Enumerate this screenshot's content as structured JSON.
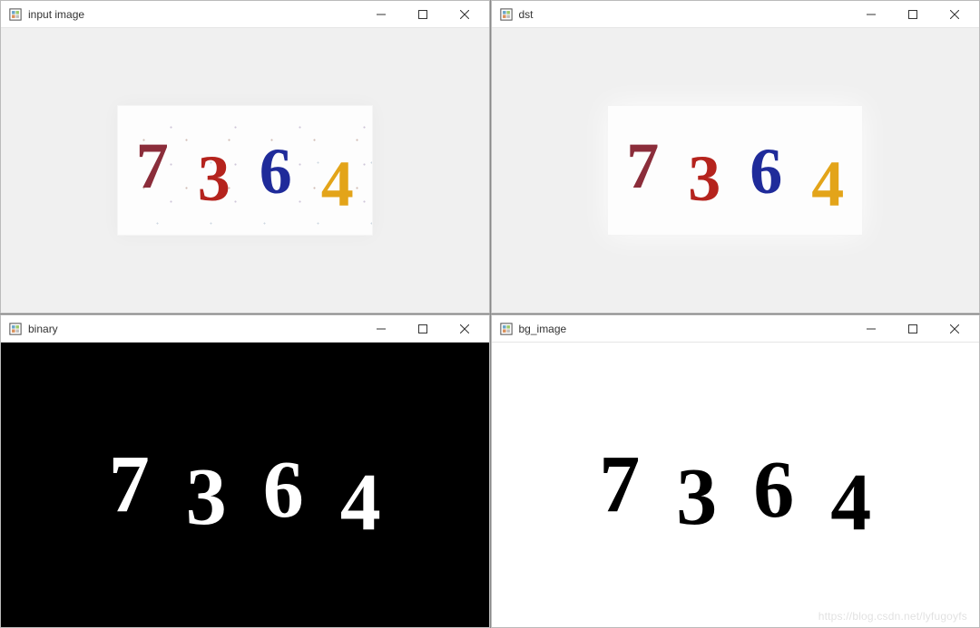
{
  "windows": [
    {
      "title": "input image"
    },
    {
      "title": "dst"
    },
    {
      "title": "binary"
    },
    {
      "title": "bg_image"
    }
  ],
  "digits": {
    "d1": "7",
    "d2": "3",
    "d3": "6",
    "d4": "4"
  },
  "watermark": "https://blog.csdn.net/lyfugoyfs"
}
